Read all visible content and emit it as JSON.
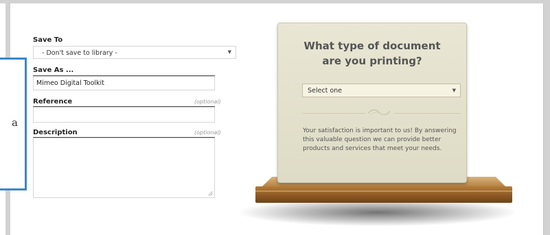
{
  "form": {
    "save_to": {
      "label": "Save To",
      "value": "- Don't save to library -"
    },
    "save_as": {
      "label": "Save As ...",
      "value": "Mimeo Digital Toolkit"
    },
    "reference": {
      "label": "Reference",
      "optional": "(optional)",
      "value": ""
    },
    "description": {
      "label": "Description",
      "optional": "(optional)",
      "value": ""
    }
  },
  "callout": {
    "char": "a"
  },
  "card": {
    "title_line1": "What type of document",
    "title_line2": "are you printing?",
    "select": {
      "value": "Select one"
    },
    "message": "Your satisfaction is important to us! By answering this valuable question we can provide better products and services that meet your needs."
  },
  "colors": {
    "accent_blue": "#3a87c8",
    "card_bg": "#e5e2cf",
    "shelf_wood": "#9c6a30"
  },
  "icons": [
    "chevron-down-icon",
    "resize-grip-icon",
    "flourish-ornament-icon"
  ]
}
